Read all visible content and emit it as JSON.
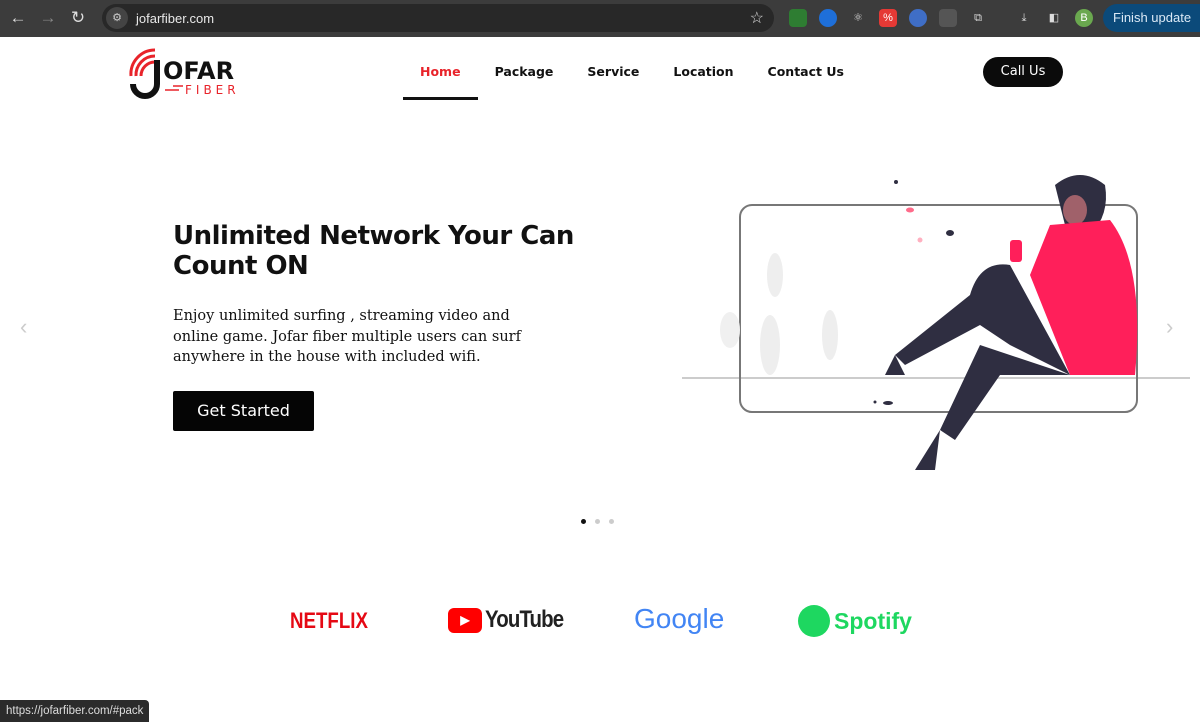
{
  "browser": {
    "url": "jofarfiber.com",
    "finish_update": "Finish update",
    "profile_initial": "B",
    "status_url": "https://jofarfiber.com/#pack"
  },
  "logo": {
    "line1": "JOFAR",
    "line2": "FIBER"
  },
  "nav": {
    "items": [
      "Home",
      "Package",
      "Service",
      "Location",
      "Contact Us"
    ],
    "active": "Home"
  },
  "call_button": "Call Us",
  "hero": {
    "title": "Unlimited Network Your Can Count ON",
    "description": "Enjoy unlimited surfing , streaming video and online game. Jofar fiber multiple users can surf anywhere in the house with included wifi.",
    "cta": "Get Started",
    "slide_count": 3,
    "active_slide": 1
  },
  "brands": [
    "NETFLIX",
    "YouTube",
    "Google",
    "Spotify"
  ],
  "colors": {
    "accent": "#e8232a",
    "pink": "#ff1f5a",
    "dark": "#2f2e41"
  }
}
